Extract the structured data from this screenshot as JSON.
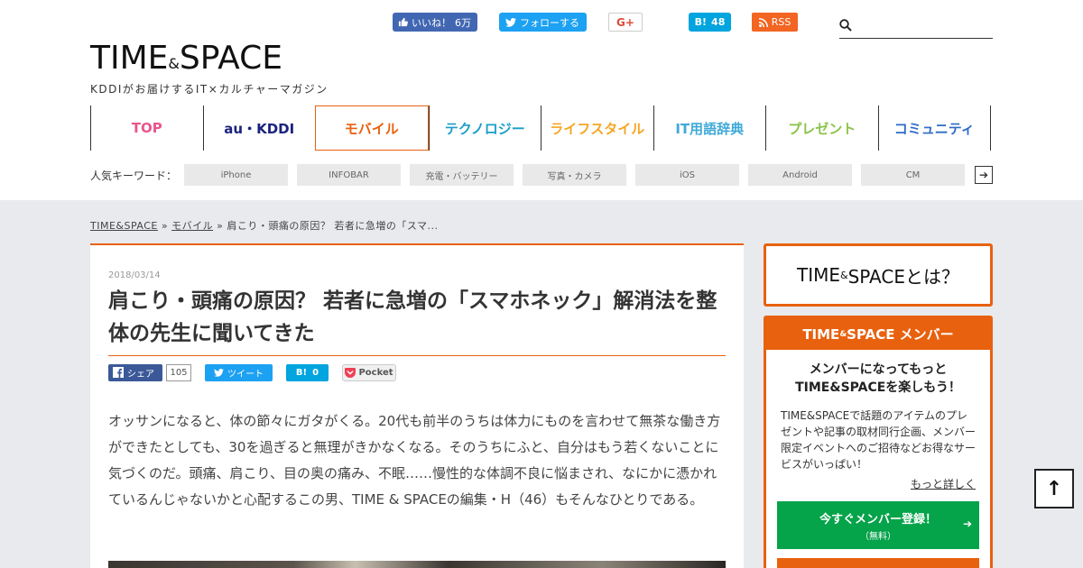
{
  "social": {
    "fb_like": "いいね！",
    "fb_like_count": "6万",
    "tw_follow": "フォローする",
    "gplus": "G+",
    "hatena_label": "B!",
    "hatena_count": "48",
    "rss": "RSS"
  },
  "search": {
    "placeholder": ""
  },
  "logo": {
    "main_left": "TIME",
    "amp": "&",
    "main_right": "SPACE",
    "tagline": "KDDIがお届けするIT×カルチャーマガジン"
  },
  "nav": {
    "items": [
      {
        "label": "TOP",
        "color": "#e8558d"
      },
      {
        "label": "au・KDDI",
        "color": "#1a237e"
      },
      {
        "label": "モバイル",
        "color": "#e8610f"
      },
      {
        "label": "テクノロジー",
        "color": "#1a9ec8"
      },
      {
        "label": "ライフスタイル",
        "color": "#f5a623"
      },
      {
        "label": "IT用語辞典",
        "color": "#3fa9d8"
      },
      {
        "label": "プレゼント",
        "color": "#8bc34a"
      },
      {
        "label": "コミュニティ",
        "color": "#2e6cc8"
      }
    ],
    "active_index": 2
  },
  "keywords": {
    "label": "人気キーワード：",
    "tags": [
      "iPhone",
      "INFOBAR",
      "充電・バッテリー",
      "写真・カメラ",
      "iOS",
      "Android",
      "CM"
    ],
    "more_arrow": "➔"
  },
  "breadcrumb": {
    "home": "TIME&SPACE",
    "sep": "»",
    "category": "モバイル",
    "current": "肩こり・頭痛の原因？ 若者に急増の「スマ..."
  },
  "article": {
    "date": "2018/03/14",
    "title": "肩こり・頭痛の原因？ 若者に急増の「スマホネック」解消法を整体の先生に聞いてきた",
    "share": {
      "fb": "シェア",
      "fb_count": "105",
      "tw": "ツイート",
      "hb_label": "B!",
      "hb_count": "0",
      "pocket": "Pocket"
    },
    "body": "オッサンになると、体の節々にガタがくる。20代も前半のうちは体力にものを言わせて無茶な働き方ができたとしても、30を過ぎると無理がきかなくなる。そのうちにふと、自分はもう若くないことに気づくのだ。頭痛、肩こり、目の奥の痛み、不眠……慢性的な体調不良に悩まされ、なにかに憑かれているんじゃないかと心配するこの男、TIME & SPACEの編集・H（46）もそんなひとりである。"
  },
  "sidebar": {
    "about_left": "TIME",
    "about_amp": "&",
    "about_right": "SPACEとは？",
    "member": {
      "head_left": "TIME",
      "head_amp": "&",
      "head_right": "SPACE メンバー",
      "catch": "メンバーになってもっとTIME&SPACEを楽しもう！",
      "desc": "TIME&SPACEで話題のアイテムのプレゼントや記事の取材同行企画、メンバー限定イベントへのご招待などお得なサービスがいっぱい！",
      "more": "もっと詳しく",
      "register": "今すぐメンバー登録！",
      "register_sub": "（無料）",
      "arrow": "➔"
    }
  },
  "to_top": "↑",
  "colors": {
    "accent": "#e8610f",
    "green": "#05a34a",
    "bg": "#e8eaee"
  }
}
